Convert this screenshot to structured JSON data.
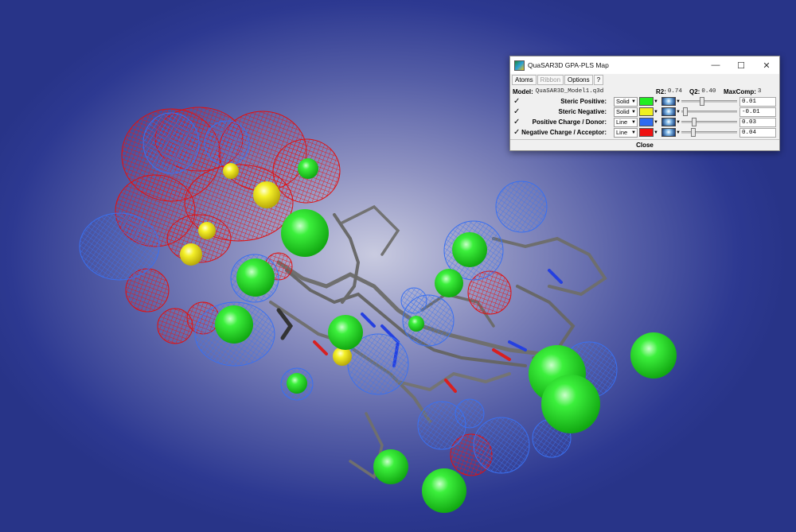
{
  "window": {
    "title": "QuaSAR3D GPA-PLS Map",
    "minimize_icon": "minimize-icon",
    "maximize_icon": "maximize-icon",
    "close_icon": "close-icon"
  },
  "menu": [
    {
      "label": "Atoms",
      "enabled": true
    },
    {
      "label": "Ribbon",
      "enabled": false
    },
    {
      "label": "Options",
      "enabled": true
    },
    {
      "label": "?",
      "enabled": true
    }
  ],
  "model": {
    "label": "Model:",
    "filename": "QuaSAR3D_Model1.q3d",
    "r2_label": "R2:",
    "r2_value": "0.74",
    "q2_label": "Q2:",
    "q2_value": "0.40",
    "maxcomp_label": "MaxComp:",
    "maxcomp_value": "3"
  },
  "maps": [
    {
      "checked": true,
      "label": "Steric Positive:",
      "style": "Solid",
      "color": "#22ee22",
      "value": "0.01",
      "slider_level": 0.35
    },
    {
      "checked": true,
      "label": "Steric Negative:",
      "style": "Solid",
      "color": "#f0f020",
      "value": "-0.01",
      "slider_level": 0.03
    },
    {
      "checked": true,
      "label": "Positive Charge / Donor:",
      "style": "Line",
      "color": "#2f6bf0",
      "value": "0.03",
      "slider_level": 0.2
    },
    {
      "checked": true,
      "label": "Negative Charge / Acceptor:",
      "style": "Line",
      "color": "#ee1111",
      "value": "0.04",
      "slider_level": 0.18
    }
  ],
  "close_label": "Close",
  "viewport": {
    "background": "#2d3991",
    "molecule_color": "#6f6f6f",
    "surface_colors": {
      "steric_positive": "#22ee22",
      "steric_negative": "#f0f020",
      "positive_charge": "#2f6bf0",
      "negative_charge": "#ee1111"
    }
  }
}
